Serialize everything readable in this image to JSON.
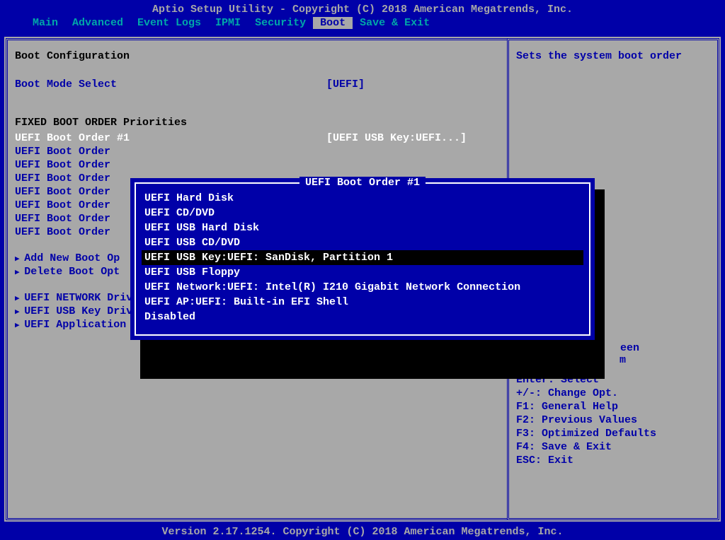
{
  "header": {
    "title": "Aptio Setup Utility - Copyright (C) 2018 American Megatrends, Inc."
  },
  "menu": {
    "items": [
      "Main",
      "Advanced",
      "Event Logs",
      "IPMI",
      "Security",
      "Boot",
      "Save & Exit"
    ],
    "active": "Boot"
  },
  "left": {
    "section1_title": "Boot Configuration",
    "boot_mode": {
      "label": "Boot Mode Select",
      "value": "[UEFI]"
    },
    "section2_title": "FIXED BOOT ORDER Priorities",
    "boot_orders": [
      {
        "label": "UEFI Boot Order #1",
        "value": "[UEFI USB Key:UEFI...]",
        "selected": true
      },
      {
        "label": "UEFI Boot Order",
        "value": ""
      },
      {
        "label": "UEFI Boot Order",
        "value": ""
      },
      {
        "label": "UEFI Boot Order",
        "value": ""
      },
      {
        "label": "UEFI Boot Order",
        "value": ""
      },
      {
        "label": "UEFI Boot Order",
        "value": ""
      },
      {
        "label": "UEFI Boot Order",
        "value": ""
      },
      {
        "label": "UEFI Boot Order",
        "value": ""
      }
    ],
    "actions": [
      "Add New Boot Op",
      "Delete Boot Opt"
    ],
    "priorities": [
      "UEFI NETWORK Driv",
      "UEFI USB Key Drive BBS Priorities",
      "UEFI Application Boot Priorities"
    ]
  },
  "right": {
    "help_text": "Sets the system boot order",
    "partial1": "een",
    "partial2": "m",
    "keys": [
      "Enter: Select",
      "+/-: Change Opt.",
      "F1: General Help",
      "F2: Previous Values",
      "F3: Optimized Defaults",
      "F4: Save & Exit",
      "ESC: Exit"
    ]
  },
  "popup": {
    "title": "UEFI Boot Order #1",
    "items": [
      "UEFI Hard Disk",
      "UEFI CD/DVD",
      "UEFI USB Hard Disk",
      "UEFI USB CD/DVD",
      "UEFI USB Key:UEFI: SanDisk, Partition 1",
      "UEFI USB Floppy",
      "UEFI Network:UEFI: Intel(R) I210 Gigabit  Network Connection",
      "UEFI AP:UEFI: Built-in EFI Shell",
      "Disabled"
    ],
    "selected_index": 4
  },
  "footer": {
    "text": "Version 2.17.1254. Copyright (C) 2018 American Megatrends, Inc."
  }
}
